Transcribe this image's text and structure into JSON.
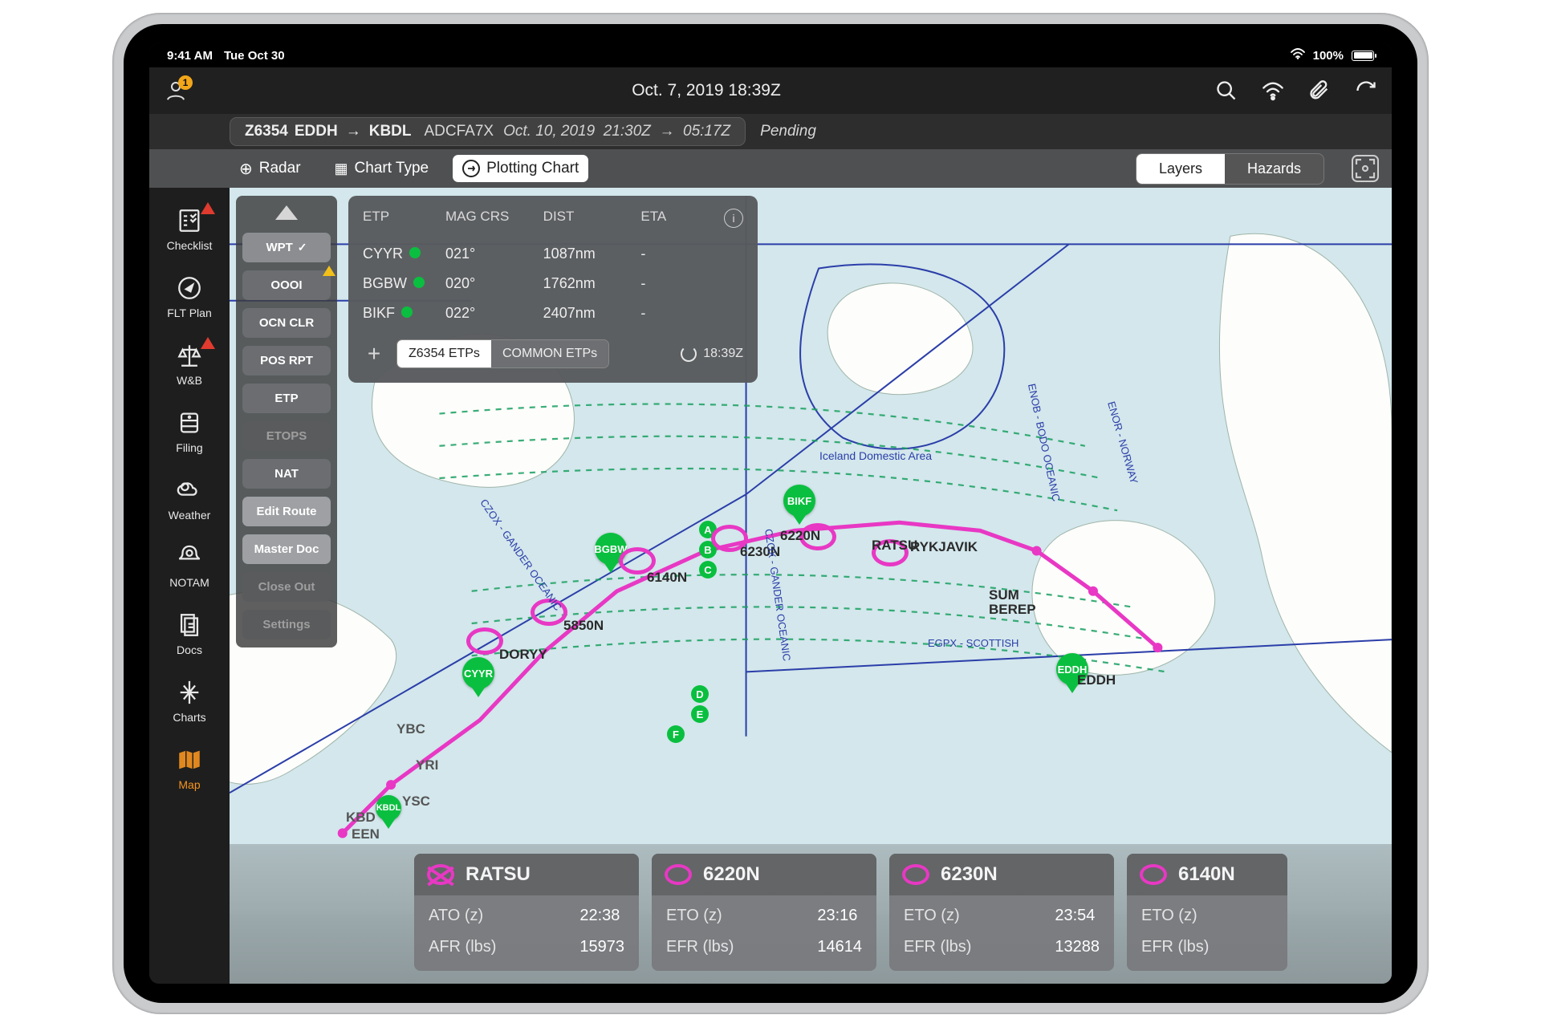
{
  "status": {
    "time": "9:41 AM",
    "date": "Tue Oct 30",
    "battery": "100%"
  },
  "appbar": {
    "badge": "1",
    "datetime": "Oct. 7, 2019  18:39Z"
  },
  "flight": {
    "callsign": "Z6354",
    "from": "EDDH",
    "to": "KBDL",
    "aircraft": "ADCFA7X",
    "dep_date": "Oct. 10, 2019",
    "dep_time": "21:30Z",
    "arr_time": "05:17Z",
    "status": "Pending"
  },
  "chart_toolbar": {
    "radar": "Radar",
    "chart_type": "Chart Type",
    "plotting": "Plotting Chart",
    "layers": "Layers",
    "hazards": "Hazards"
  },
  "leftnav": [
    {
      "id": "checklist",
      "label": "Checklist",
      "warn": "red"
    },
    {
      "id": "fltplan",
      "label": "FLT Plan"
    },
    {
      "id": "wb",
      "label": "W&B",
      "warn": "red"
    },
    {
      "id": "filing",
      "label": "Filing"
    },
    {
      "id": "weather",
      "label": "Weather"
    },
    {
      "id": "notam",
      "label": "NOTAM"
    },
    {
      "id": "docs",
      "label": "Docs"
    },
    {
      "id": "charts",
      "label": "Charts"
    },
    {
      "id": "map",
      "label": "Map",
      "active": true
    }
  ],
  "tools": [
    {
      "id": "wpt",
      "label": "WPT",
      "state": "sel",
      "check": true
    },
    {
      "id": "oooi",
      "label": "OOOI",
      "warn": true
    },
    {
      "id": "ocnclr",
      "label": "OCN CLR"
    },
    {
      "id": "posrpt",
      "label": "POS RPT"
    },
    {
      "id": "etp",
      "label": "ETP"
    },
    {
      "id": "etops",
      "label": "ETOPS",
      "state": "dim"
    },
    {
      "id": "nat",
      "label": "NAT"
    },
    {
      "id": "editroute",
      "label": "Edit Route",
      "state": "light"
    },
    {
      "id": "masterdoc",
      "label": "Master Doc",
      "state": "light"
    },
    {
      "id": "closeout",
      "label": "Close Out",
      "state": "dim"
    },
    {
      "id": "settings",
      "label": "Settings",
      "state": "dim"
    }
  ],
  "etp": {
    "columns": [
      "ETP",
      "MAG CRS",
      "DIST",
      "ETA"
    ],
    "rows": [
      {
        "etp": "CYYR",
        "crs": "021°",
        "dist": "1087nm",
        "eta": "-"
      },
      {
        "etp": "BGBW",
        "crs": "020°",
        "dist": "1762nm",
        "eta": "-"
      },
      {
        "etp": "BIKF",
        "crs": "022°",
        "dist": "2407nm",
        "eta": "-"
      }
    ],
    "seg_a": "Z6354 ETPs",
    "seg_b": "COMMON ETPs",
    "refresh_time": "18:39Z"
  },
  "cards": [
    {
      "name": "RATSU",
      "past": true,
      "rows": [
        [
          "ATO (z)",
          "22:38"
        ],
        [
          "AFR (lbs)",
          "15973"
        ]
      ]
    },
    {
      "name": "6220N",
      "rows": [
        [
          "ETO (z)",
          "23:16"
        ],
        [
          "EFR (lbs)",
          "14614"
        ]
      ]
    },
    {
      "name": "6230N",
      "rows": [
        [
          "ETO (z)",
          "23:54"
        ],
        [
          "EFR (lbs)",
          "13288"
        ]
      ]
    },
    {
      "name": "6140N",
      "rows": [
        [
          "ETO (z)",
          ""
        ],
        [
          "EFR (lbs)",
          ""
        ]
      ]
    }
  ],
  "map": {
    "area_label": "Iceland Domestic Area",
    "region_czox": "CZOX - GANDER OCEANIC",
    "region_enob": "ENOB - BODO OCEANIC",
    "region_scot": "EGPX - SCOTTISH",
    "region_norway": "ENOR - NORWAY",
    "pins": {
      "cyyr": "CYYR",
      "bgbw": "BGBW",
      "bikf": "BIKF",
      "eddh": "EDDH",
      "kbdl": "KBDL"
    },
    "wp_labels": {
      "doryy": "DORYY",
      "n5850": "5850N",
      "n6140": "6140N",
      "n6230": "6230N",
      "n6220": "6220N",
      "ratsu": "RATSU",
      "sum": "SUM",
      "berep": "BEREP",
      "rykjavik": "RYKJAVIK",
      "ybc": "YBC",
      "yri": "YRI",
      "ysc": "YSC",
      "een": "EEN",
      "kbd": "KBD"
    },
    "letters": [
      "A",
      "B",
      "C",
      "D",
      "E",
      "F"
    ]
  }
}
